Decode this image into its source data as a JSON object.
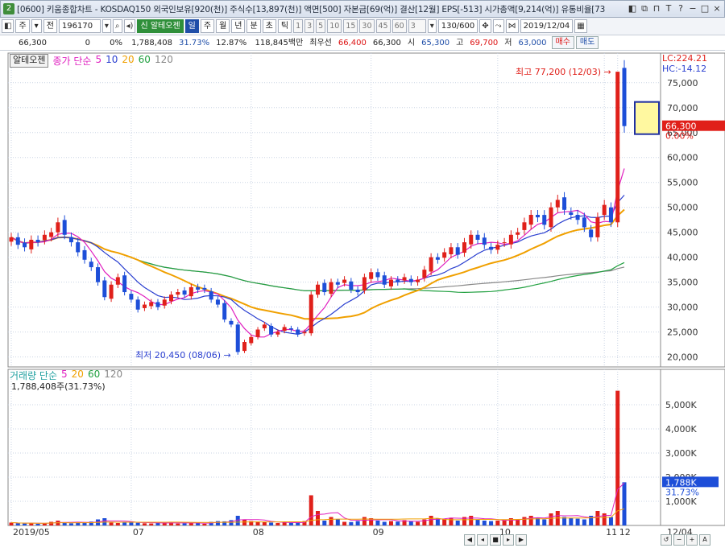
{
  "window": {
    "badge": "2",
    "title": "[0600] 키움종합차트 - KOSDAQ150 외국인보유[920(천)] 주식수[13,897(천)] 액면[500] 자본금[69(억)] 결산[12월] EPS[-513] 시가총액[9,214(억)] 유통비율[73",
    "buttons": [
      "◧",
      "⧉",
      "⊓",
      "T",
      "?",
      "−",
      "□",
      "×"
    ]
  },
  "toolbar": {
    "menu1": "주",
    "menu2": "전",
    "code": "196170",
    "stock_name": "알테오젠",
    "periods": [
      "일",
      "주",
      "월",
      "년",
      "분",
      "초",
      "틱"
    ],
    "active_period": "일",
    "intervals": [
      "1",
      "3",
      "5",
      "10",
      "15",
      "30",
      "45",
      "60"
    ],
    "interval_value": "3",
    "count": "130/600",
    "date": "2019/12/04",
    "buy": "매수",
    "sell": "매도"
  },
  "quote": {
    "price": "66,300",
    "change": "0",
    "change_pct": "0%",
    "volume": "1,788,408",
    "turnover_pct": "31.73%",
    "rate2": "12.87%",
    "amount": "118,845백만",
    "best_label": "최우선",
    "best_ask": "66,400",
    "best_bid": "66,300",
    "open_label": "시",
    "open": "65,300",
    "high_label": "고",
    "high": "69,700",
    "low_label": "저",
    "low": "63,000"
  },
  "price_panel": {
    "name_box": "알테오젠",
    "legend_label": "종가 단순",
    "ma_periods": [
      "5",
      "10",
      "20",
      "60",
      "120"
    ],
    "ma_colors": [
      "#e020c0",
      "#2a3fd0",
      "#f0a000",
      "#21a040",
      "#888888"
    ],
    "lc": "LC:224.21",
    "hc": "HC:-14.12",
    "current_tag": "66,300",
    "current_pct": "0.00%",
    "high_annotation": "최고 77,200 (12/03)",
    "low_annotation": "최저 20,450 (08/06)",
    "y_ticks": [
      "75,000",
      "70,000",
      "65,000",
      "60,000",
      "55,000",
      "50,000",
      "45,000",
      "40,000",
      "35,000",
      "30,000",
      "25,000",
      "20,000"
    ]
  },
  "volume_panel": {
    "legend_label": "거래량 단순",
    "ma_periods": [
      "5",
      "20",
      "60",
      "120"
    ],
    "ma_colors": [
      "#e020c0",
      "#f0a000",
      "#21a040",
      "#888888"
    ],
    "summary": "1,788,408주(31.73%)",
    "current_tag": "1,788K",
    "current_pct": "31.73%",
    "y_ticks": [
      "5,000K",
      "4,000K",
      "3,000K",
      "2,000K",
      "1,000K"
    ]
  },
  "x_axis": {
    "labels": [
      "2019/05",
      "07",
      "08",
      "09",
      "10",
      "11",
      "12"
    ],
    "right_label": "12/04"
  },
  "colors": {
    "up": "#e0201a",
    "down": "#1d4ed8",
    "ma5": "#e020c0",
    "ma10": "#2a3fd0",
    "ma20": "#f0a000",
    "ma60": "#21a040",
    "ma120": "#888888"
  },
  "chart_data": {
    "type": "candlestick",
    "x_start": "2019/05",
    "x_end": "2019/12/04",
    "ylim": [
      18000,
      79000
    ],
    "closes": [
      44000,
      42500,
      42000,
      43500,
      43000,
      44500,
      45000,
      47000,
      44500,
      43000,
      41000,
      39500,
      38000,
      35000,
      32000,
      34500,
      36000,
      33000,
      31500,
      29500,
      30500,
      31000,
      30000,
      31500,
      32500,
      33000,
      32500,
      34000,
      33500,
      33500,
      31500,
      30500,
      27500,
      26500,
      21000,
      23000,
      24000,
      25500,
      26500,
      24500,
      25000,
      26000,
      25500,
      24500,
      25000,
      32500,
      34500,
      33000,
      35000,
      34500,
      35500,
      33500,
      33000,
      36000,
      37000,
      36000,
      34500,
      35500,
      35000,
      36000,
      35000,
      35500,
      37500,
      40000,
      39500,
      41000,
      42000,
      40500,
      43000,
      44500,
      43500,
      42500,
      41500,
      42500,
      43000,
      44500,
      45000,
      47000,
      48500,
      48000,
      46500,
      50000,
      51500,
      49500,
      48500,
      47500,
      46000,
      44000,
      48000,
      50500,
      47000,
      77200,
      66300
    ],
    "volume_K": [
      120,
      90,
      80,
      100,
      70,
      90,
      150,
      200,
      120,
      90,
      130,
      110,
      160,
      250,
      300,
      120,
      100,
      140,
      150,
      110,
      90,
      80,
      100,
      120,
      130,
      80,
      90,
      110,
      100,
      70,
      150,
      180,
      170,
      220,
      400,
      250,
      180,
      160,
      140,
      120,
      100,
      130,
      110,
      120,
      180,
      1250,
      600,
      200,
      350,
      250,
      150,
      140,
      180,
      350,
      300,
      200,
      150,
      180,
      160,
      220,
      180,
      150,
      250,
      400,
      300,
      280,
      320,
      200,
      350,
      400,
      250,
      200,
      180,
      200,
      220,
      300,
      250,
      350,
      400,
      300,
      250,
      500,
      600,
      350,
      300,
      280,
      250,
      400,
      600,
      500,
      350,
      5580,
      1788
    ]
  }
}
